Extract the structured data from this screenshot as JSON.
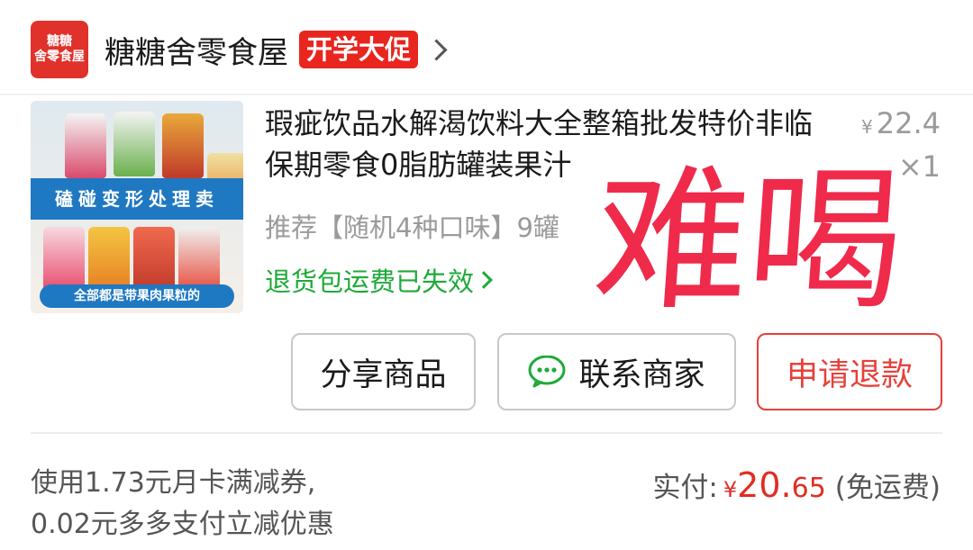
{
  "store": {
    "logo_line1": "糖糖",
    "logo_line2": "舍零食屋",
    "name": "糖糖舍零食屋",
    "promo": "开学大促"
  },
  "product": {
    "title": "瑕疵饮品水解渴饮料大全整箱批发特价非临保期零食0脂肪罐装果汁",
    "price_symbol": "¥",
    "price": "22.4",
    "quantity": "×1",
    "spec": "推荐【随机4种口味】9罐",
    "return_note": "退货包运费已失效",
    "image": {
      "band_text": "磕碰变形处理卖",
      "bottom_text": "全部都是带果肉果粒的"
    }
  },
  "overlay": {
    "text": "难喝",
    "color": "#ef2a4b"
  },
  "buttons": {
    "share": "分享商品",
    "contact": "联系商家",
    "refund": "申请退款"
  },
  "footer": {
    "coupon_line1": "使用1.73元月卡满减券,",
    "coupon_line2": "0.02元多多支付立减优惠",
    "paid_label": "实付:",
    "paid_symbol": "¥",
    "paid_int": "20.",
    "paid_dec": "65",
    "shipping": "(免运费)"
  },
  "colors": {
    "brand_red": "#e02e24",
    "green": "#1eaa39",
    "wechat_green": "#1eaa39"
  }
}
